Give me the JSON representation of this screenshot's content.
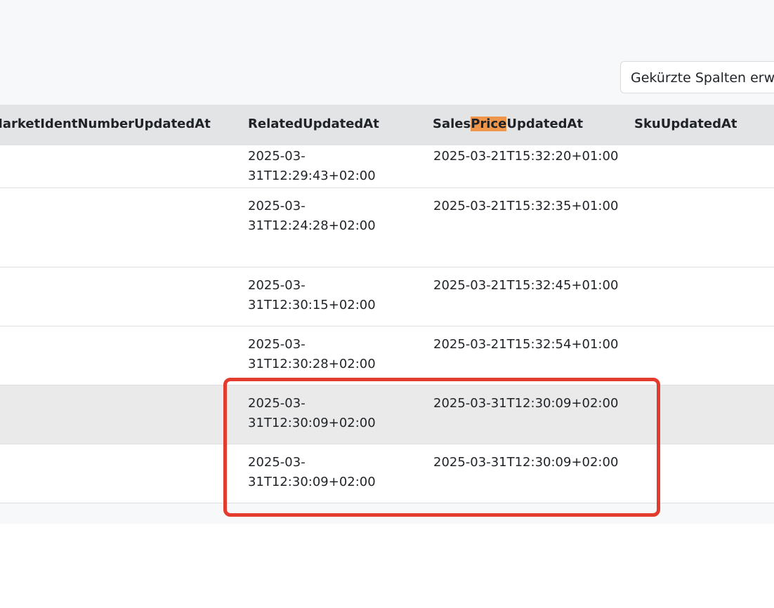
{
  "toolbar": {
    "expand_columns_label": "Gekürzte Spalten erweitern"
  },
  "table": {
    "headers": {
      "market_ident": "MarketIdentNumberUpdatedAt",
      "related": "RelatedUpdatedAt",
      "sales_prefix": "Sales",
      "sales_highlight": "Price",
      "sales_suffix": "UpdatedAt",
      "sku": "SkuUpdatedAt"
    },
    "rows": [
      {
        "related": "2025-03-31T12:29:43+02:00",
        "sales": "2025-03-21T15:32:20+01:00"
      },
      {
        "related": "2025-03-31T12:24:28+02:00",
        "sales": "2025-03-21T15:32:35+01:00"
      },
      {
        "related": "2025-03-31T12:30:15+02:00",
        "sales": "2025-03-21T15:32:45+01:00"
      },
      {
        "related": "2025-03-31T12:30:28+02:00",
        "sales": "2025-03-21T15:32:54+01:00"
      },
      {
        "related": "2025-03-31T12:30:09+02:00",
        "sales": "2025-03-31T12:30:09+02:00"
      },
      {
        "related": "2025-03-31T12:30:09+02:00",
        "sales": "2025-03-31T12:30:09+02:00"
      }
    ]
  },
  "colors": {
    "highlight": "#f0964a",
    "annotation": "#e33b2e",
    "header_bg": "#e3e4e6",
    "selected_row_bg": "#eaeaea"
  }
}
